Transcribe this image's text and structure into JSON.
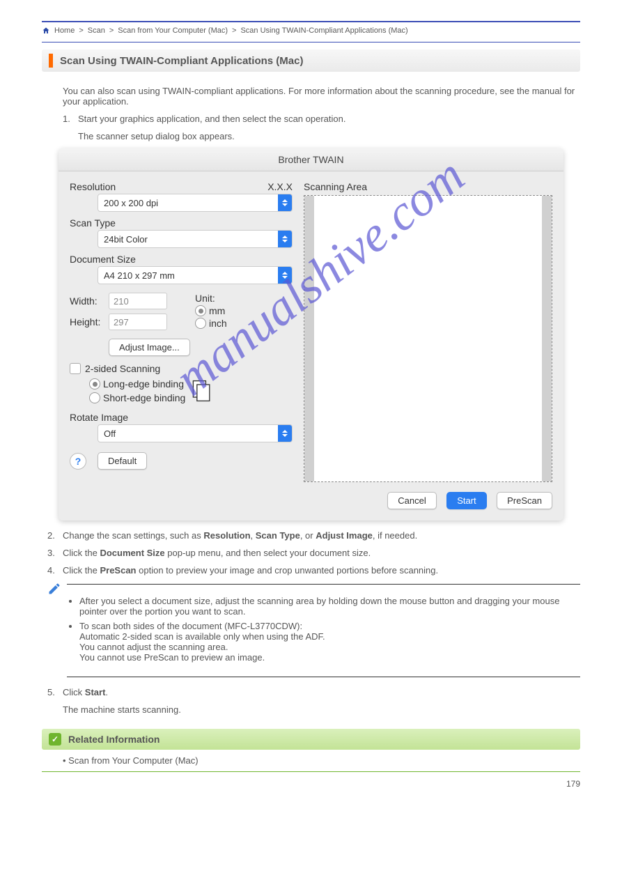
{
  "breadcrumb": {
    "l1": "Home",
    "sep": ">",
    "l2": "Scan",
    "l3": "Scan from Your Computer (Mac)",
    "l4": "Scan Using TWAIN-Compliant Applications (Mac)"
  },
  "section_title": "Scan Using TWAIN-Compliant Applications (Mac)",
  "intro1": "You can also scan using TWAIN-compliant applications. For more information about the scanning procedure, see the manual for your application.",
  "step1_num": "1.",
  "step1": "Start your graphics application, and then select the scan operation.",
  "step1b": "The scanner setup dialog box appears.",
  "dialog": {
    "title": "Brother TWAIN",
    "resolution_label": "Resolution",
    "version": "X.X.X",
    "resolution_value": "200 x 200 dpi",
    "scantype_label": "Scan Type",
    "scantype_value": "24bit Color",
    "docsize_label": "Document Size",
    "docsize_value": "A4  210 x 297 mm",
    "width_label": "Width:",
    "width_value": "210",
    "height_label": "Height:",
    "height_value": "297",
    "unit_label": "Unit:",
    "unit_mm": "mm",
    "unit_inch": "inch",
    "adjust_btn": "Adjust Image...",
    "twosided_label": "2-sided Scanning",
    "longedge": "Long-edge binding",
    "shortedge": "Short-edge binding",
    "rotate_label": "Rotate Image",
    "rotate_value": "Off",
    "default_btn": "Default",
    "scanarea_label": "Scanning Area",
    "cancel_btn": "Cancel",
    "start_btn": "Start",
    "prescan_btn": "PreScan"
  },
  "step2_num": "2.",
  "step2": "Change the scan settings, such as ",
  "step2_b1": "Resolution",
  "step2_mid": ", ",
  "step2_b2": "Scan Type",
  "step2_mid2": ", or ",
  "step2_b3": "Adjust Image",
  "step2_end": ", if needed.",
  "step3_num": "3.",
  "step3a": "Click the ",
  "step3_b": "Document Size",
  "step3b": " pop-up menu, and then select your document size.",
  "step4_num": "4.",
  "step4a": "Click the ",
  "step4_b": "PreScan",
  "step4b": " option to preview your image and crop unwanted portions before scanning.",
  "note1a": "After you select a document size, adjust the scanning area by holding down the mouse button and dragging your mouse pointer over the portion you want to scan.",
  "note2a": "To scan both sides of the document (MFC-L3770CDW):",
  "note2b": "Automatic 2-sided scan is available only when using the ADF.",
  "note2c": "You cannot adjust the scanning area.",
  "note2d": "You cannot use PreScan to preview an image.",
  "step5_num": "5.",
  "step5a": "Click ",
  "step5_b": "Start",
  "step5b": ".",
  "step5_after": "The machine starts scanning.",
  "related_title": "Related Information",
  "related_link": "Scan from Your Computer (Mac)",
  "page_number": "179",
  "watermark": "manualshive.com"
}
